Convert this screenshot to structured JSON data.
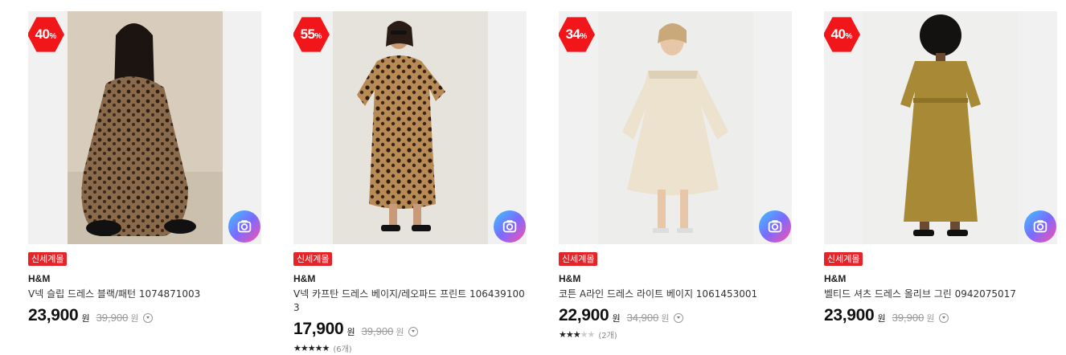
{
  "products": [
    {
      "discount": "40",
      "discount_unit": "%",
      "badge": "신세계몰",
      "brand": "H&M",
      "title": "V넥 슬립 드레스 블랙/패턴 1074871003",
      "price": "23,900",
      "price_unit": "원",
      "original_price": "39,900",
      "original_unit": "원",
      "stars": null,
      "reviews": null
    },
    {
      "discount": "55",
      "discount_unit": "%",
      "badge": "신세계몰",
      "brand": "H&M",
      "title": "V넥 카프탄 드레스 베이지/레오파드 프린트 1064391003",
      "price": "17,900",
      "price_unit": "원",
      "original_price": "39,900",
      "original_unit": "원",
      "stars": 5,
      "reviews": "(6개)"
    },
    {
      "discount": "34",
      "discount_unit": "%",
      "badge": "신세계몰",
      "brand": "H&M",
      "title": "코튼 A라인 드레스 라이트 베이지 1061453001",
      "price": "22,900",
      "price_unit": "원",
      "original_price": "34,900",
      "original_unit": "원",
      "stars": 3,
      "reviews": "(2개)"
    },
    {
      "discount": "40",
      "discount_unit": "%",
      "badge": "신세계몰",
      "brand": "H&M",
      "title": "벨티드 셔츠 드레스 올리브 그린 0942075017",
      "price": "23,900",
      "price_unit": "원",
      "original_price": "39,900",
      "original_unit": "원",
      "stars": null,
      "reviews": null
    }
  ],
  "icons": {
    "lens": "camera-lens-icon",
    "info": "chevron-down-circle-icon",
    "star": "star-icon"
  },
  "colors": {
    "discount": "#f0161a",
    "badge": "#e3252a"
  }
}
